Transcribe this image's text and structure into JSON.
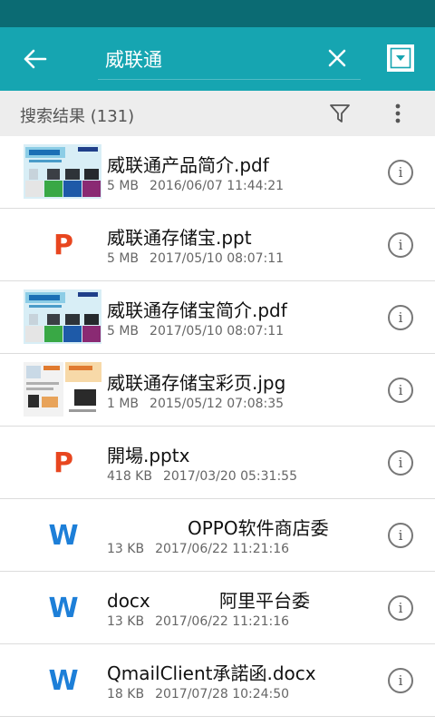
{
  "header": {
    "search_value": "威联通",
    "back_icon": "arrow-left-icon",
    "clear_icon": "close-icon",
    "dropdown_icon": "dropdown-triangle-icon",
    "bar_color": "#16a5b1",
    "status_color": "#0b6b73"
  },
  "results": {
    "title": "搜索结果 (131)",
    "filter_icon": "filter-icon",
    "more_icon": "more-vert-icon"
  },
  "files": [
    {
      "name": "威联通产品简介.pdf",
      "size": "5 MB",
      "date": "2016/06/07 11:44:21",
      "kind": "thumb-brochure",
      "badge_color": "#e8461f"
    },
    {
      "name": "威联通存储宝.ppt",
      "size": "5 MB",
      "date": "2017/05/10 08:07:11",
      "kind": "P"
    },
    {
      "name": "威联通存储宝简介.pdf",
      "size": "5 MB",
      "date": "2017/05/10 08:07:11",
      "kind": "thumb-brochure"
    },
    {
      "name": "威联通存储宝彩页.jpg",
      "size": "1 MB",
      "date": "2015/05/12 07:08:35",
      "kind": "thumb-flyer"
    },
    {
      "name": "開場.pptx",
      "size": "418 KB",
      "date": "2017/03/20 05:31:55",
      "kind": "P"
    },
    {
      "name": "              OPPO软件商店委",
      "size": "13 KB",
      "date": "2017/06/22 11:21:16",
      "kind": "W"
    },
    {
      "name": "docx            阿里平台委",
      "size": "13 KB",
      "date": "2017/06/22 11:21:16",
      "kind": "W"
    },
    {
      "name": "QmailClient承諾函.docx",
      "size": "18 KB",
      "date": "2017/07/28 10:24:50",
      "kind": "W"
    }
  ],
  "type_letters": {
    "P": "P",
    "W": "W"
  },
  "info_icon_label": "i",
  "colors": {
    "ppt": "#e8461f",
    "word": "#1d7fd8",
    "divider": "#dcdcdc"
  }
}
